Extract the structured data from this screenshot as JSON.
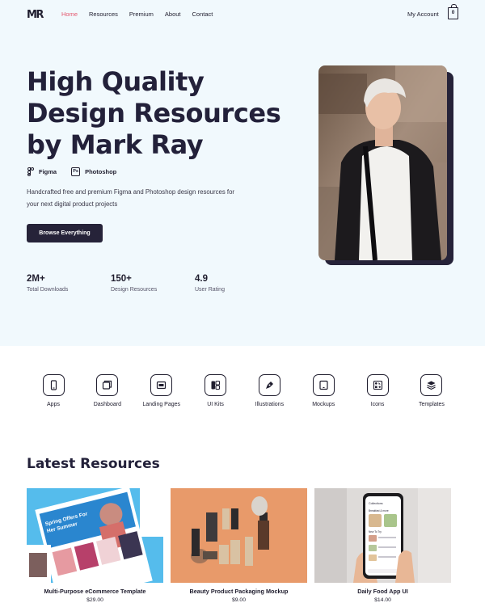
{
  "brand": {
    "logo": "MR"
  },
  "nav": {
    "items": [
      {
        "label": "Home",
        "active": true
      },
      {
        "label": "Resources",
        "active": false
      },
      {
        "label": "Premium",
        "active": false
      },
      {
        "label": "About",
        "active": false
      },
      {
        "label": "Contact",
        "active": false
      }
    ],
    "account": "My Account",
    "cart_count": "0"
  },
  "hero": {
    "title_line1": "High Quality",
    "title_line2": "Design Resources",
    "title_line3": "by Mark Ray",
    "tools": [
      {
        "label": "Figma",
        "icon": "figma-icon"
      },
      {
        "label": "Photoshop",
        "icon": "photoshop-icon"
      }
    ],
    "description": "Handcrafted free and premium Figma and Photoshop design resources for your next digital product projects",
    "cta": "Browse Everything",
    "stats": [
      {
        "value": "2M+",
        "label": "Total Downloads"
      },
      {
        "value": "150+",
        "label": "Design Resources"
      },
      {
        "value": "4.9",
        "label": "User Rating"
      }
    ]
  },
  "categories": [
    {
      "label": "Apps",
      "icon": "mobile-icon"
    },
    {
      "label": "Dashboard",
      "icon": "dashboard-icon"
    },
    {
      "label": "Landing Pages",
      "icon": "landing-page-icon"
    },
    {
      "label": "UI Kits",
      "icon": "ui-kit-icon"
    },
    {
      "label": "Illustrations",
      "icon": "pen-icon"
    },
    {
      "label": "Mockups",
      "icon": "tablet-icon"
    },
    {
      "label": "Icons",
      "icon": "icons-icon"
    },
    {
      "label": "Templates",
      "icon": "layers-icon"
    }
  ],
  "latest": {
    "heading": "Latest Resources",
    "items": [
      {
        "title": "Multi-Purpose eCommerce Template",
        "price": "$29.00",
        "banner_text_1": "Spring Offers For",
        "banner_text_2": "Her Summer"
      },
      {
        "title": "Beauty Product Packaging Mockup",
        "price": "$9.00"
      },
      {
        "title": "Daily Food App UI",
        "price": "$14.00",
        "screen_title": "Collections",
        "section_1": "Breakfast & more",
        "section_2": "New To Try"
      }
    ]
  },
  "colors": {
    "accent": "#e4576e",
    "dark": "#262339",
    "hero_bg": "#f1f9fd"
  }
}
